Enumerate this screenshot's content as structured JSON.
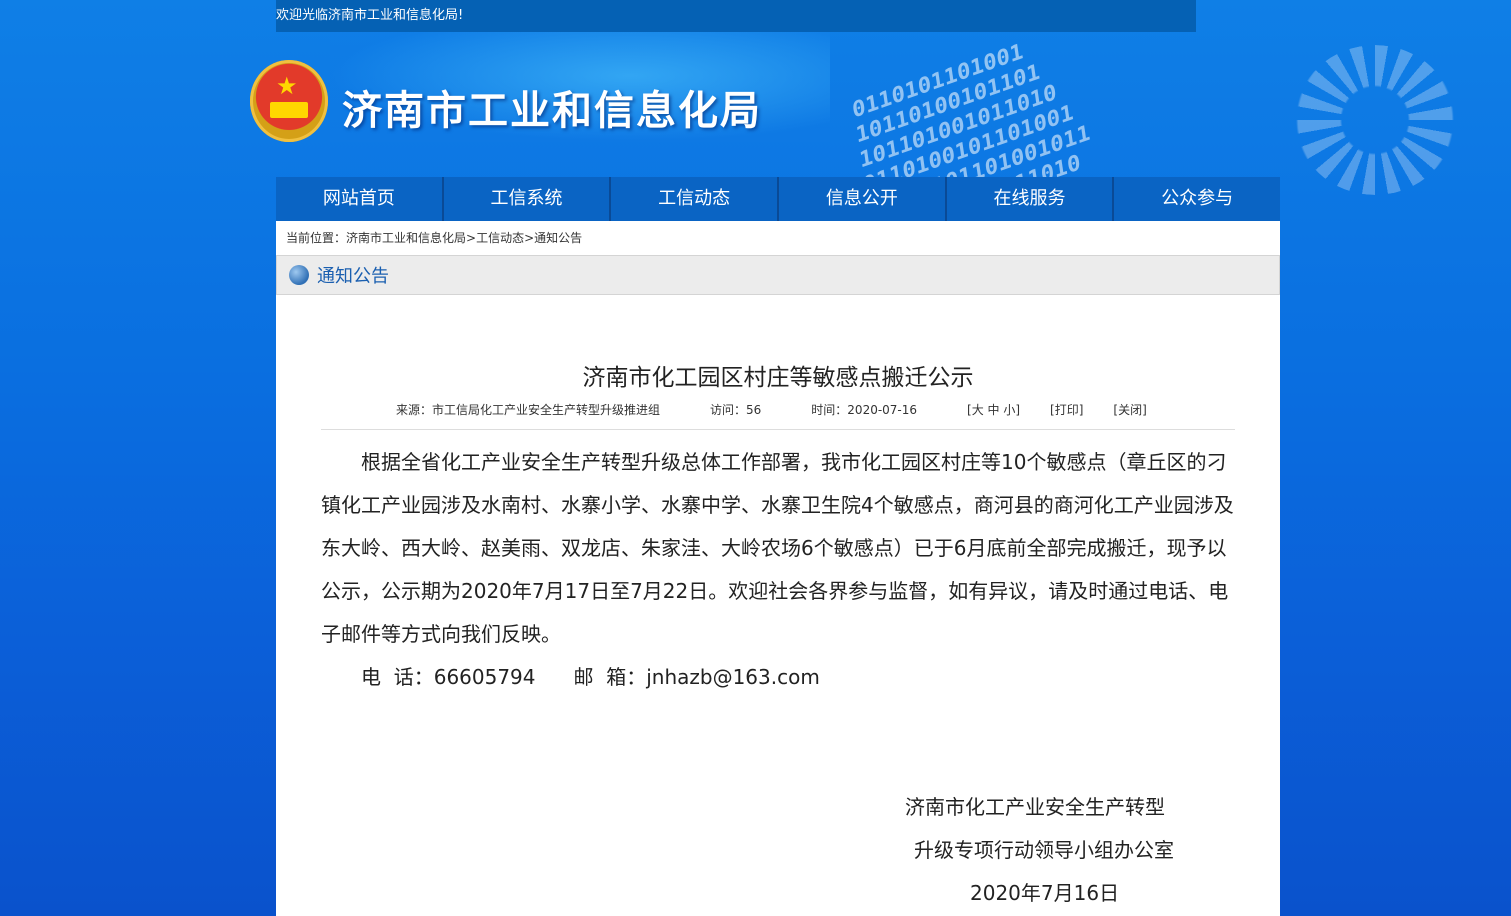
{
  "topbar": {
    "welcome": "欢迎光临济南市工业和信息化局!"
  },
  "header": {
    "site_title": "济南市工业和信息化局"
  },
  "nav": {
    "items": [
      "网站首页",
      "工信系统",
      "工信动态",
      "信息公开",
      "在线服务",
      "公众参与"
    ]
  },
  "breadcrumb": {
    "prefix": "当前位置：",
    "crumbs": [
      "济南市工业和信息化局",
      "工信动态",
      "通知公告"
    ],
    "sep": ">"
  },
  "section": {
    "title": "通知公告"
  },
  "article": {
    "title": "济南市化工园区村庄等敏感点搬迁公示",
    "meta": {
      "source": "来源：市工信局化工产业安全生产转型升级推进组",
      "visits": "访问：56",
      "time": "时间：2020-07-16",
      "font_size": "[大 中 小]",
      "print": "[打印]",
      "close": "[关闭]"
    },
    "paragraph": "根据全省化工产业安全生产转型升级总体工作部署，我市化工园区村庄等10个敏感点（章丘区的刁镇化工产业园涉及水南村、水寨小学、水寨中学、水寨卫生院4个敏感点，商河县的商河化工产业园涉及东大岭、西大岭、赵美雨、双龙店、朱家洼、大岭农场6个敏感点）已于6月底前全部完成搬迁，现予以公示，公示期为2020年7月17日至7月22日。欢迎社会各界参与监督，如有异议，请及时通过电话、电子邮件等方式向我们反映。",
    "phone": "电  话：66605794",
    "email": "邮  箱：jnhazb@163.com",
    "signature_line1": "济南市化工产业安全生产转型",
    "signature_line2": "升级专项行动领导小组办公室",
    "signature_date": "2020年7月16日"
  }
}
